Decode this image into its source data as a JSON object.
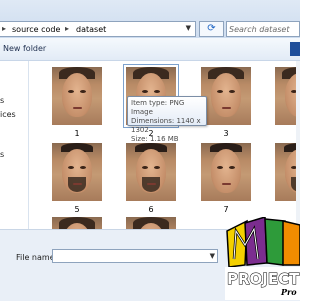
{
  "address_bar": {
    "breadcrumbs": [
      "source code",
      "dataset"
    ],
    "separator": "▸",
    "search_placeholder": "Search dataset"
  },
  "toolbar": {
    "new_folder_label": "New folder"
  },
  "nav_pane": {
    "items": [
      "s",
      "ices",
      "s"
    ]
  },
  "files": [
    {
      "label": "1",
      "type": "female"
    },
    {
      "label": "2",
      "type": "female",
      "selected": true
    },
    {
      "label": "3",
      "type": "female"
    },
    {
      "label": "",
      "type": "female"
    },
    {
      "label": "5",
      "type": "male"
    },
    {
      "label": "6",
      "type": "male"
    },
    {
      "label": "7",
      "type": "male"
    },
    {
      "label": "",
      "type": "male"
    },
    {
      "label": "",
      "type": "female"
    },
    {
      "label": "",
      "type": "female"
    }
  ],
  "tooltip": {
    "item_type": "Item type: PNG Image",
    "dimensions": "Dimensions: 1140 x 1302",
    "size": "Size: 1.16 MB"
  },
  "bottom": {
    "file_name_label": "File name:",
    "file_name_value": ""
  },
  "watermark": {
    "line1": "PROJECT B",
    "line2": "Pro"
  },
  "colors": {
    "accent": "#1d64c4",
    "frame": "#dfe9f5",
    "logo_yellow": "#f4d000",
    "logo_purple": "#7b2d8f",
    "logo_orange": "#f28c00",
    "logo_green": "#2e9b3a"
  }
}
